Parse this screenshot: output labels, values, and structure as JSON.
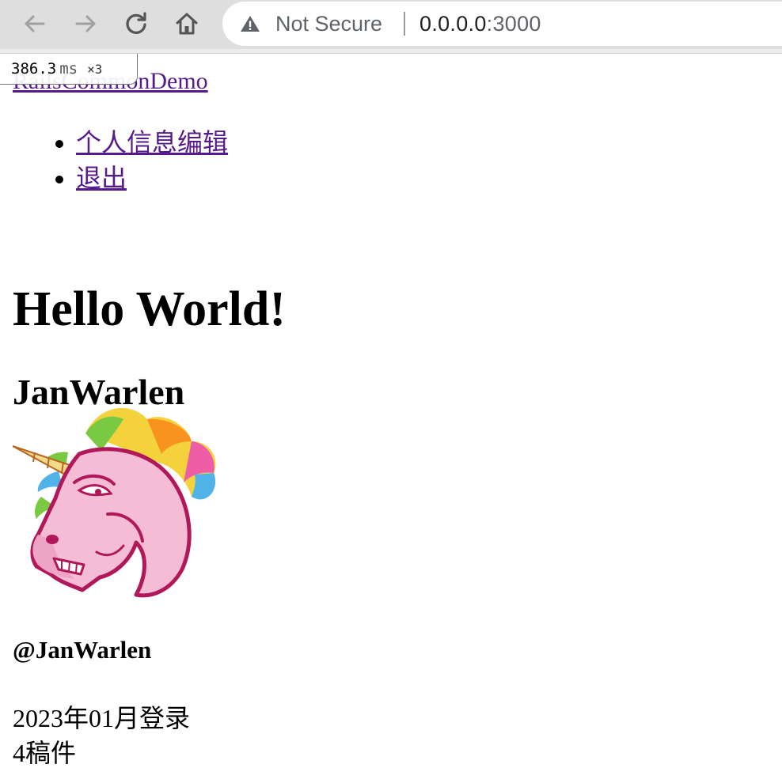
{
  "browser": {
    "security_label": "Not Secure",
    "url_host": "0.0.0.0",
    "url_port": ":3000",
    "icons": {
      "back": "arrow-left-icon",
      "forward": "arrow-right-icon",
      "reload": "reload-icon",
      "home": "home-icon",
      "warning": "warning-triangle-icon"
    }
  },
  "site": {
    "brand": "RailsCommonDemo",
    "nav": [
      {
        "label": "个人信息编辑"
      },
      {
        "label": "退出"
      }
    ]
  },
  "main": {
    "heading": "Hello World!",
    "user_name": "JanWarlen",
    "avatar_icon": "unicorn-avatar",
    "handle": "@JanWarlen",
    "joined": "2023年01月登录",
    "posts": "4稿件"
  },
  "debug": {
    "timing": "386.3",
    "unit": "ms",
    "count": "×3"
  },
  "colors": {
    "link": "#551a8b",
    "toolbar": "#dedede"
  }
}
